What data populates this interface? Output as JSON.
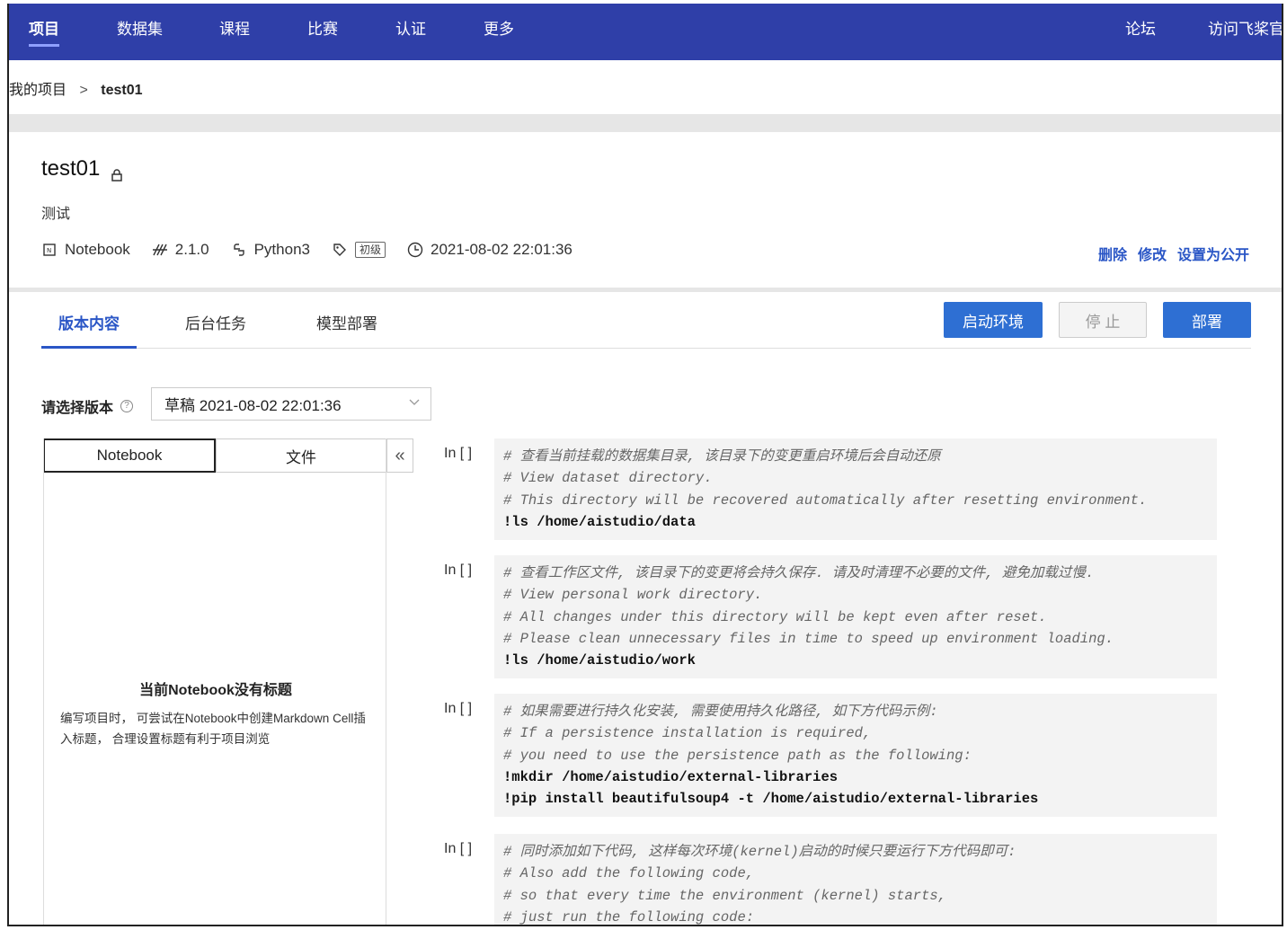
{
  "nav": {
    "items": [
      "项目",
      "数据集",
      "课程",
      "比赛",
      "认证",
      "更多"
    ],
    "right": [
      "论坛",
      "访问飞桨官"
    ]
  },
  "breadcrumb": {
    "parent": "我的项目",
    "sep": ">",
    "current": "test01"
  },
  "project": {
    "title": "test01",
    "desc": "测试",
    "type": "Notebook",
    "version": "2.1.0",
    "lang": "Python3",
    "level": "初级",
    "time": "2021-08-02 22:01:36",
    "actions": [
      "删除",
      "修改",
      "设置为公开"
    ]
  },
  "tabs": [
    "版本内容",
    "后台任务",
    "模型部署"
  ],
  "buttons": {
    "start": "启动环境",
    "stop": "停 止",
    "deploy": "部署"
  },
  "version_select": {
    "label": "请选择版本",
    "value": "草稿 2021-08-02 22:01:36"
  },
  "left_panel": {
    "tabs": [
      "Notebook",
      "文件"
    ],
    "collapse": "«",
    "empty_title": "当前Notebook没有标题",
    "empty_desc": "编写项目时， 可尝试在Notebook中创建Markdown Cell插入标题， 合理设置标题有利于项目浏览"
  },
  "cells": [
    {
      "prompt": "In [ ]",
      "lines": [
        {
          "t": "cm",
          "s": "# 查看当前挂载的数据集目录, 该目录下的变更重启环境后会自动还原"
        },
        {
          "t": "cm",
          "s": "# View dataset directory."
        },
        {
          "t": "cm",
          "s": "# This directory will be recovered automatically after resetting environment."
        },
        {
          "t": "cmd",
          "s": "!ls /home/aistudio/data"
        }
      ]
    },
    {
      "prompt": "In [ ]",
      "lines": [
        {
          "t": "cm",
          "s": "# 查看工作区文件, 该目录下的变更将会持久保存. 请及时清理不必要的文件, 避免加载过慢."
        },
        {
          "t": "cm",
          "s": "# View personal work directory."
        },
        {
          "t": "cm",
          "s": "# All changes under this directory will be kept even after reset."
        },
        {
          "t": "cm",
          "s": "# Please clean unnecessary files in time to speed up environment loading."
        },
        {
          "t": "cmd",
          "s": "!ls /home/aistudio/work"
        }
      ]
    },
    {
      "prompt": "In [ ]",
      "lines": [
        {
          "t": "cm",
          "s": "# 如果需要进行持久化安装, 需要使用持久化路径, 如下方代码示例:"
        },
        {
          "t": "cm",
          "s": "# If a persistence installation is required,"
        },
        {
          "t": "cm",
          "s": "# you need to use the persistence path as the following:"
        },
        {
          "t": "cmd",
          "s": "!mkdir /home/aistudio/external-libraries"
        },
        {
          "t": "cmd",
          "s": "!pip install beautifulsoup4 -t /home/aistudio/external-libraries"
        }
      ]
    },
    {
      "prompt": "In [ ]",
      "lines": [
        {
          "t": "cm",
          "s": "# 同时添加如下代码, 这样每次环境(kernel)启动的时候只要运行下方代码即可:"
        },
        {
          "t": "cm",
          "s": "# Also add the following code,"
        },
        {
          "t": "cm",
          "s": "# so that every time the environment (kernel) starts,"
        },
        {
          "t": "cm",
          "s": "# just run the following code:"
        }
      ]
    }
  ],
  "colors": {
    "nav_bg": "#2f3fa8",
    "link": "#2a56c6",
    "primary_button": "#2e6fd3"
  }
}
